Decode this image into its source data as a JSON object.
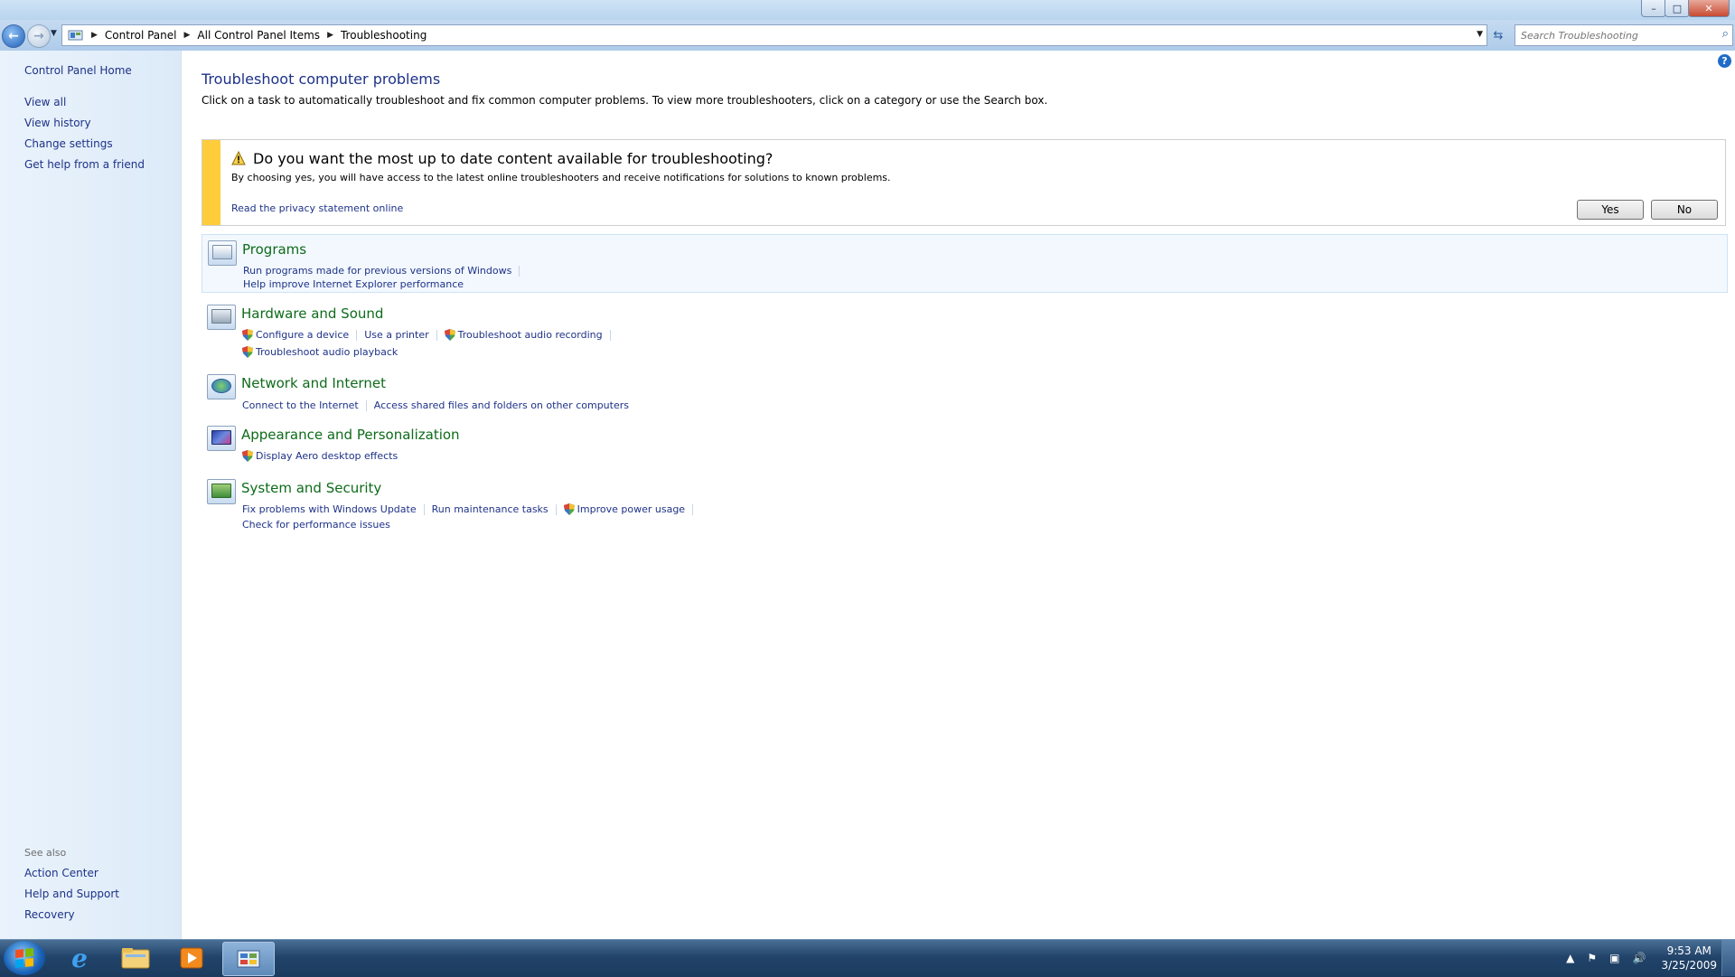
{
  "window": {
    "minimize": "–",
    "maximize": "□",
    "close": "✕"
  },
  "address": {
    "crumbs": [
      "Control Panel",
      "All Control Panel Items",
      "Troubleshooting"
    ],
    "search_placeholder": "Search Troubleshooting"
  },
  "sidebar": {
    "items": [
      "Control Panel Home",
      "View all",
      "View history",
      "Change settings",
      "Get help from a friend"
    ],
    "see_also_label": "See also",
    "see_also": [
      "Action Center",
      "Help and Support",
      "Recovery"
    ]
  },
  "main": {
    "title": "Troubleshoot computer problems",
    "description": "Click on a task to automatically troubleshoot and fix common computer problems. To view more troubleshooters, click on a category or use the Search box.",
    "info": {
      "question": "Do you want the most up to date content available for troubleshooting?",
      "detail": "By choosing yes, you will have access to the latest online troubleshooters and receive notifications for solutions to known problems.",
      "privacy": "Read the privacy statement online",
      "yes": "Yes",
      "no": "No"
    },
    "categories": [
      {
        "name": "Programs",
        "links": [
          "Run programs made for previous versions of Windows",
          "Help improve Internet Explorer performance"
        ]
      },
      {
        "name": "Hardware and Sound",
        "links": [
          "Configure a device",
          "Use a printer",
          "Troubleshoot audio recording",
          "Troubleshoot audio playback"
        ]
      },
      {
        "name": "Network and Internet",
        "links": [
          "Connect to the Internet",
          "Access shared files and folders on other computers"
        ]
      },
      {
        "name": "Appearance and Personalization",
        "links": [
          "Display Aero desktop effects"
        ]
      },
      {
        "name": "System and Security",
        "links": [
          "Fix problems with Windows Update",
          "Run maintenance tasks",
          "Improve power usage",
          "Check for performance issues"
        ]
      }
    ]
  },
  "taskbar": {
    "time": "9:53 AM",
    "date": "3/25/2009"
  },
  "colors": {
    "link": "#1e3287",
    "category": "#0e6b1a",
    "warning_stripe": "#ffcc3c"
  }
}
